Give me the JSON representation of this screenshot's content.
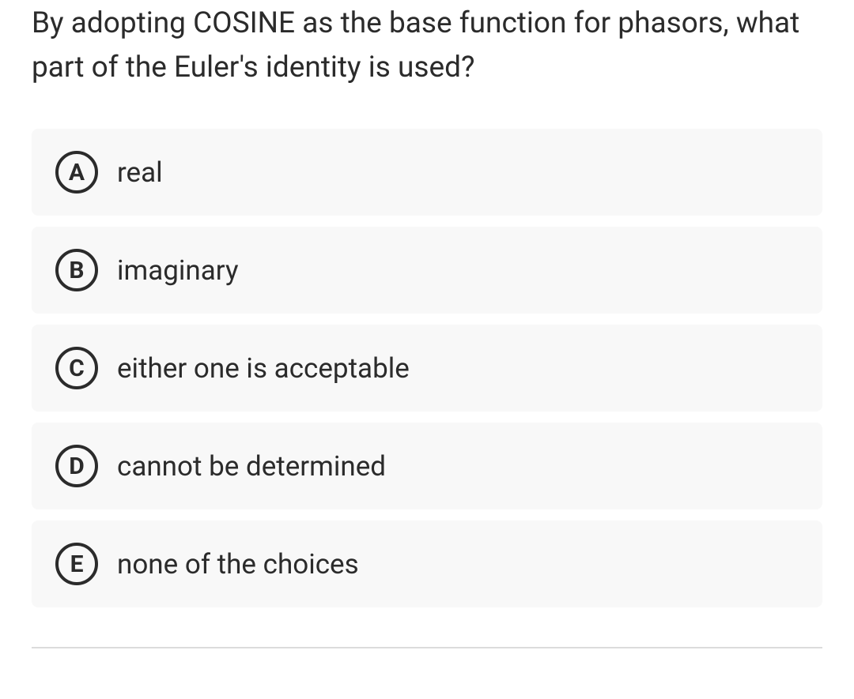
{
  "question": "By adopting COSINE as the base function for phasors, what part of the Euler's identity is used?",
  "options": [
    {
      "letter": "A",
      "text": "real"
    },
    {
      "letter": "B",
      "text": "imaginary"
    },
    {
      "letter": "C",
      "text": "either one is acceptable"
    },
    {
      "letter": "D",
      "text": "cannot be determined"
    },
    {
      "letter": "E",
      "text": "none of the choices"
    }
  ]
}
